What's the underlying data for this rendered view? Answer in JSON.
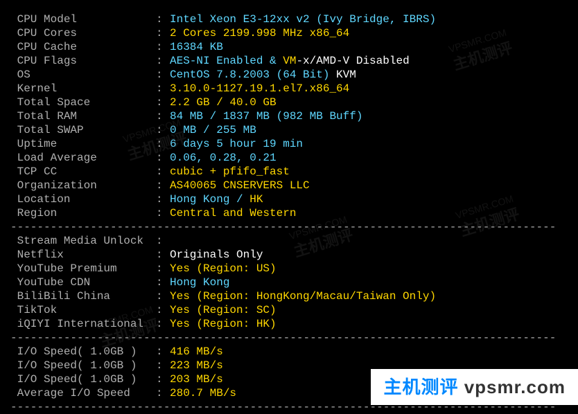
{
  "sys": [
    {
      "label": "CPU Model",
      "val": "Intel Xeon E3-12xx v2 (Ivy Bridge, IBRS)",
      "c": "value"
    },
    {
      "label": "CPU Cores",
      "val": "2 Cores 2199.998 MHz x86_64",
      "c": "yellow"
    },
    {
      "label": "CPU Cache",
      "val": "16384 KB",
      "c": "value"
    },
    {
      "label": "CPU Flags",
      "val": "AES-NI Enabled & ",
      "c": "value",
      "suffix": "VM",
      "sc": "yellow",
      "suffix2": "-x/AMD-V Disabled",
      "sc2": "white"
    },
    {
      "label": "OS",
      "val": "CentOS 7.8.2003 (64 Bit) ",
      "c": "value",
      "suffix": "KVM",
      "sc": "white"
    },
    {
      "label": "Kernel",
      "val": "3.10.0-1127.19.1.el7.x86_64",
      "c": "yellow"
    },
    {
      "label": "Total Space",
      "val": "2.2 GB / 40.0 GB",
      "c": "yellow"
    },
    {
      "label": "Total RAM",
      "val": "84 MB / 1837 MB (982 MB Buff)",
      "c": "value"
    },
    {
      "label": "Total SWAP",
      "val": "0 MB / 255 MB",
      "c": "value"
    },
    {
      "label": "Uptime",
      "val": "6 days 5 hour 19 min",
      "c": "value"
    },
    {
      "label": "Load Average",
      "val": "0.06, 0.28, 0.21",
      "c": "value"
    },
    {
      "label": "TCP CC",
      "val": "cubic + pfifo_fast",
      "c": "yellow"
    },
    {
      "label": "Organization",
      "val": "AS40065 CNSERVERS LLC",
      "c": "yellow"
    },
    {
      "label": "Location",
      "val": "Hong Kong / ",
      "c": "value",
      "suffix": "HK",
      "sc": "yellow"
    },
    {
      "label": "Region",
      "val": "Central and Western",
      "c": "yellow"
    }
  ],
  "stream_header": "Stream Media Unlock",
  "stream": [
    {
      "label": "Netflix",
      "val": "Originals Only",
      "c": "white"
    },
    {
      "label": "YouTube Premium",
      "val": "Yes (Region: US)",
      "c": "yellow"
    },
    {
      "label": "YouTube CDN",
      "val": "Hong Kong",
      "c": "value"
    },
    {
      "label": "BiliBili China",
      "val": "Yes (Region: HongKong/Macau/Taiwan Only)",
      "c": "yellow"
    },
    {
      "label": "TikTok",
      "val": "Yes (Region: SC)",
      "c": "yellow"
    },
    {
      "label": "iQIYI International",
      "val": "Yes (Region: HK)",
      "c": "yellow"
    }
  ],
  "io": [
    {
      "label": "I/O Speed( 1.0GB )",
      "val": "416 MB/s",
      "c": "yellow"
    },
    {
      "label": "I/O Speed( 1.0GB )",
      "val": "223 MB/s",
      "c": "yellow"
    },
    {
      "label": "I/O Speed( 1.0GB )",
      "val": "203 MB/s",
      "c": "yellow"
    },
    {
      "label": "Average I/O Speed",
      "val": "280.7 MB/s",
      "c": "yellow"
    }
  ],
  "sep": "----------------------------------------------------------------------------------",
  "watermark_url": "VPSMR.COM",
  "watermark_text": "主机测评",
  "banner_main": "主机测评",
  "banner_domain": "vpsmr.com"
}
